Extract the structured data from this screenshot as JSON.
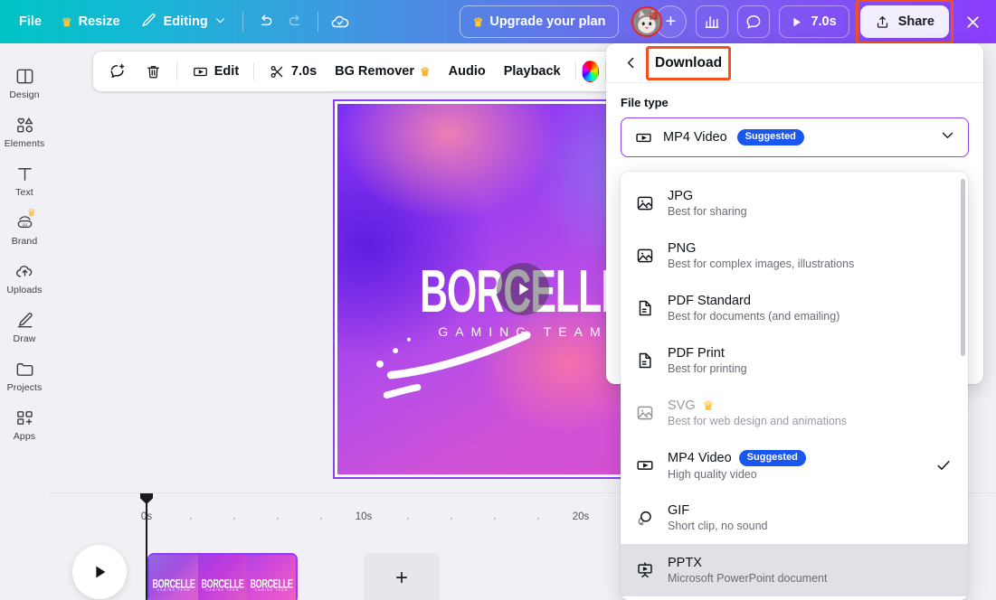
{
  "topbar": {
    "file": "File",
    "resize": "Resize",
    "editing": "Editing",
    "undo_icon": "undo-icon",
    "redo_icon": "redo-icon",
    "cloud_icon": "cloud-saved-icon",
    "upgrade": "Upgrade your plan",
    "avatar": "avatar",
    "invite_plus": "+",
    "analytics_icon": "analytics-icon",
    "comment_icon": "comment-icon",
    "play_duration": "7.0s",
    "share": "Share",
    "close": "×"
  },
  "sidebar": {
    "items": [
      {
        "label": "Design",
        "icon": "design-icon",
        "pro": false
      },
      {
        "label": "Elements",
        "icon": "elements-icon",
        "pro": false
      },
      {
        "label": "Text",
        "icon": "text-icon",
        "pro": false
      },
      {
        "label": "Brand",
        "icon": "brand-icon",
        "pro": true
      },
      {
        "label": "Uploads",
        "icon": "uploads-icon",
        "pro": false
      },
      {
        "label": "Draw",
        "icon": "draw-icon",
        "pro": false
      },
      {
        "label": "Projects",
        "icon": "projects-icon",
        "pro": false
      },
      {
        "label": "Apps",
        "icon": "apps-icon",
        "pro": false
      }
    ]
  },
  "edit_toolbar": {
    "comment_icon": "add-comment-icon",
    "delete_icon": "trash-icon",
    "edit": "Edit",
    "trim_duration": "7.0s",
    "bg_remover": "BG Remover",
    "audio": "Audio",
    "playback": "Playback",
    "color_wheel": "color-wheel-icon"
  },
  "canvas": {
    "title": "BORCELLE",
    "subtitle": "GAMING TEAM",
    "play_icon": "play-icon"
  },
  "timeline": {
    "ticks": [
      "0s",
      "10s",
      "20s"
    ],
    "play_icon": "play-icon",
    "clip_title": "BORCELLE",
    "clip_subtitle": "GAMING TEAM",
    "add_page": "+"
  },
  "panel": {
    "back_icon": "back-chevron-icon",
    "title": "Download",
    "highlight_color": "#f4511e",
    "file_type_label": "File type",
    "selected": {
      "icon": "mp4-video-icon",
      "label": "MP4 Video",
      "badge": "Suggested"
    },
    "chevron_icon": "chevron-down-icon"
  },
  "dropdown": {
    "options": [
      {
        "icon": "image-icon",
        "title": "JPG",
        "desc": "Best for sharing",
        "badge": "",
        "pro": false,
        "checked": false,
        "hovered": false
      },
      {
        "icon": "image-icon",
        "title": "PNG",
        "desc": "Best for complex images, illustrations",
        "badge": "",
        "pro": false,
        "checked": false,
        "hovered": false
      },
      {
        "icon": "doc-icon",
        "title": "PDF Standard",
        "desc": "Best for documents (and emailing)",
        "badge": "",
        "pro": false,
        "checked": false,
        "hovered": false
      },
      {
        "icon": "doc-icon",
        "title": "PDF Print",
        "desc": "Best for printing",
        "badge": "",
        "pro": false,
        "checked": false,
        "hovered": false
      },
      {
        "icon": "image-icon",
        "title": "SVG",
        "desc": "Best for web design and animations",
        "badge": "",
        "pro": true,
        "checked": false,
        "hovered": false
      },
      {
        "icon": "video-icon",
        "title": "MP4 Video",
        "desc": "High quality video",
        "badge": "Suggested",
        "pro": false,
        "checked": true,
        "hovered": false
      },
      {
        "icon": "gif-icon",
        "title": "GIF",
        "desc": "Short clip, no sound",
        "badge": "",
        "pro": false,
        "checked": false,
        "hovered": false
      },
      {
        "icon": "pptx-icon",
        "title": "PPTX",
        "desc": "Microsoft PowerPoint document",
        "badge": "",
        "pro": false,
        "checked": false,
        "hovered": true
      }
    ]
  },
  "colors": {
    "brand_purple": "#8b3dfc",
    "badge_blue": "#1a56f0",
    "highlight_orange": "#f4511e",
    "crown_gold": "#ffb224"
  }
}
